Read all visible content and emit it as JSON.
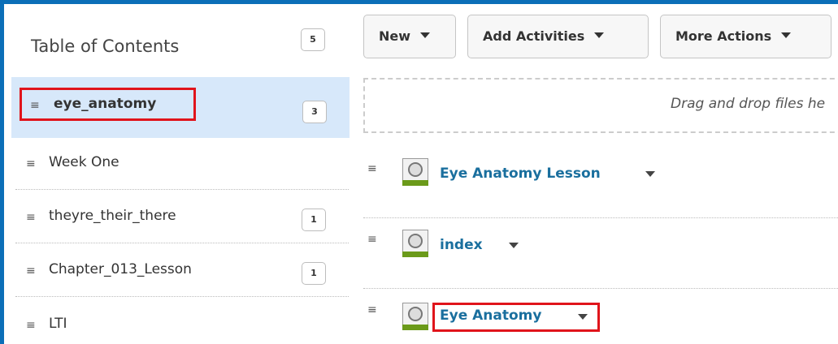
{
  "toc": {
    "title": "Table of Contents",
    "total_count": "5",
    "items": [
      {
        "label": "eye_anatomy",
        "count": "3"
      },
      {
        "label": "Week One",
        "count": ""
      },
      {
        "label": "theyre_their_there",
        "count": "1"
      },
      {
        "label": "Chapter_013_Lesson",
        "count": "1"
      },
      {
        "label": "LTI",
        "count": ""
      }
    ]
  },
  "toolbar": {
    "new_label": "New",
    "add_activities_label": "Add Activities",
    "more_actions_label": "More Actions"
  },
  "dropzone": {
    "text": "Drag and drop files he"
  },
  "topics": [
    {
      "label": "Eye Anatomy Lesson"
    },
    {
      "label": "index"
    },
    {
      "label": "Eye Anatomy"
    }
  ],
  "colors": {
    "accent_border": "#0b6fb8",
    "highlight": "#e0141b",
    "selected_bg": "#d7e8fa",
    "link": "#1a6f9e"
  }
}
